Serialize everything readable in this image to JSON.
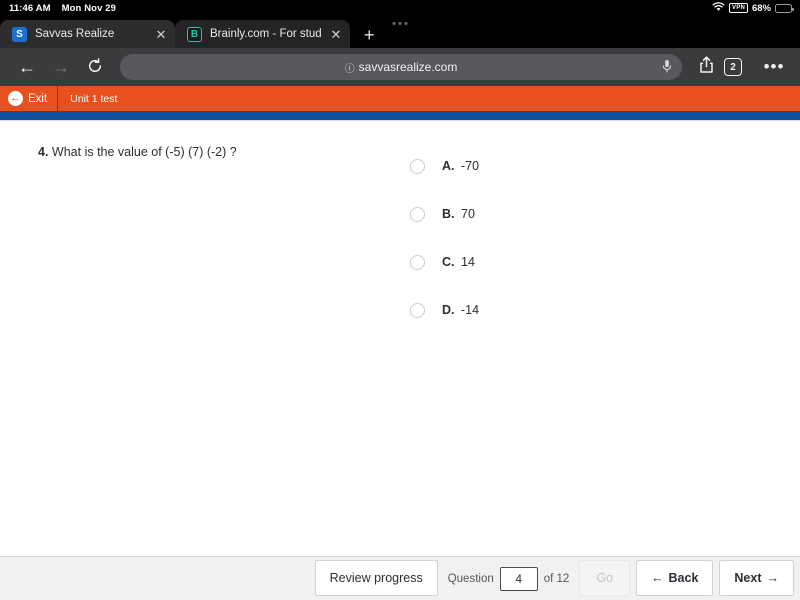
{
  "status_bar": {
    "time": "11:46 AM",
    "date": "Mon Nov 29",
    "wifi_icon": "wifi-icon",
    "vpn_label": "VPN",
    "battery_percent": "68%",
    "battery_icon": "battery-icon"
  },
  "browser": {
    "tabs": [
      {
        "title": "Savvas Realize",
        "favicon": "savvas-favicon",
        "favicon_letter": "S",
        "close_icon": "close-icon",
        "active": true
      },
      {
        "title": "Brainly.com - For student",
        "favicon": "brainly-favicon",
        "favicon_letter": "B",
        "close_icon": "close-icon",
        "active": false
      }
    ],
    "new_tab_icon": "plus-icon",
    "multitask_handle": "multitask-handle-icon",
    "toolbar": {
      "back_icon": "arrow-left-icon",
      "forward_icon": "arrow-right-icon",
      "reload_icon": "reload-icon",
      "url": "savvasrealize.com",
      "url_lock_icon": "info-icon",
      "mic_icon": "microphone-icon",
      "share_icon": "share-icon",
      "tab_count": "2",
      "menu_icon": "more-dots-icon"
    }
  },
  "app_header": {
    "exit_label": "Exit",
    "exit_icon": "arrow-left-circle-icon",
    "assignment_title": "Unit 1 test",
    "accent_orange": "#e8511d",
    "progress_blue": "#10529e"
  },
  "question": {
    "number": "4.",
    "prompt": "What is the value of (-5) (7) (-2) ?",
    "choices": [
      {
        "letter": "A.",
        "value": "-70",
        "selected": false
      },
      {
        "letter": "B.",
        "value": "70",
        "selected": false
      },
      {
        "letter": "C.",
        "value": "14",
        "selected": false
      },
      {
        "letter": "D.",
        "value": "-14",
        "selected": false
      }
    ]
  },
  "bottom_bar": {
    "review_progress_label": "Review progress",
    "question_label": "Question",
    "question_number_value": "4",
    "of_label": "of 12",
    "go_label": "Go",
    "back_label": "Back",
    "back_icon": "arrow-left-icon",
    "next_label": "Next",
    "next_icon": "arrow-right-icon"
  }
}
